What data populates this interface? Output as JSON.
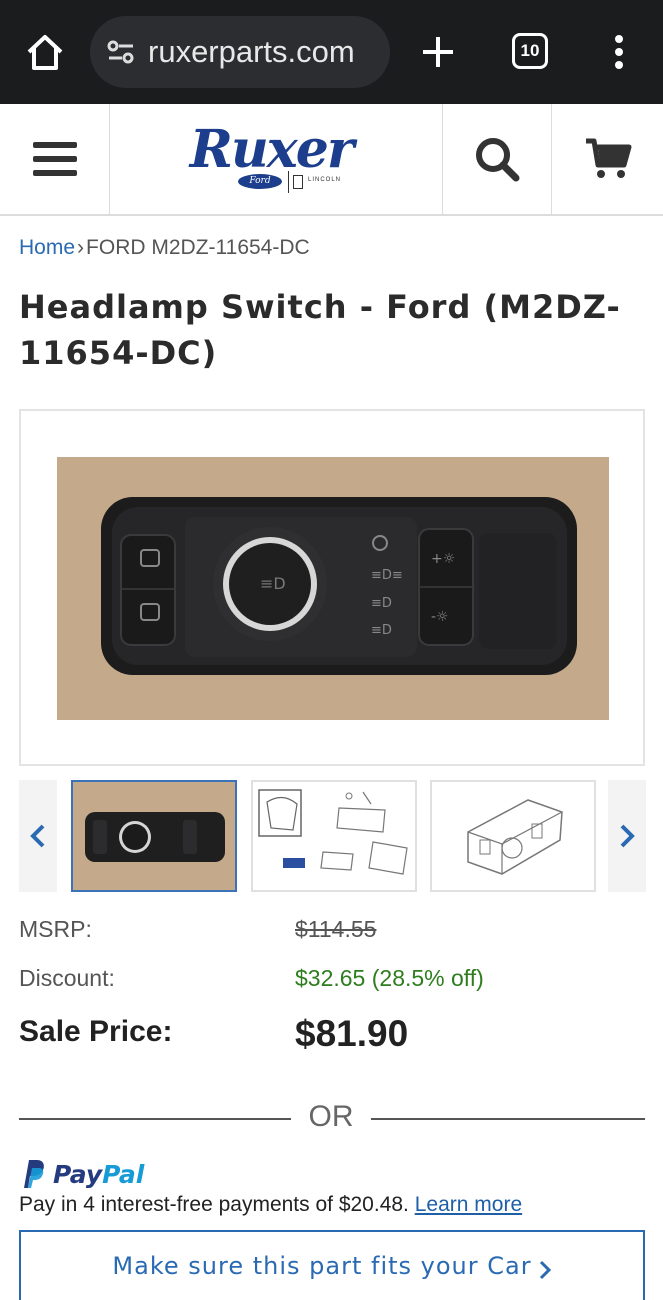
{
  "browser": {
    "url": "ruxerparts.com",
    "tab_count": "10",
    "icons": [
      "home-icon",
      "site-info-icon",
      "plus-icon",
      "tabs-icon",
      "more-vert-icon"
    ]
  },
  "header": {
    "logo_text": "Ruxer",
    "logo_sub_ford": "Ford",
    "logo_sub_lincoln": "LINCOLN",
    "icons": [
      "hamburger-icon",
      "search-icon",
      "cart-icon"
    ],
    "brand_color": "#1d3e8c"
  },
  "breadcrumb": {
    "home": "Home",
    "separator": "›",
    "current": "FORD M2DZ-11654-DC"
  },
  "product": {
    "title": "Headlamp Switch - Ford (M2DZ-11654-DC)"
  },
  "gallery": {
    "selected_index": 0,
    "thumbnail_count": 3,
    "icons": [
      "chevron-left-icon",
      "chevron-right-icon"
    ]
  },
  "pricing": {
    "msrp_label": "MSRP:",
    "msrp_value": "$114.55",
    "discount_label": "Discount:",
    "discount_value": "$32.65 (28.5% off)",
    "sale_label": "Sale Price:",
    "sale_value": "$81.90",
    "discount_color": "#2e7d1e"
  },
  "divider": {
    "text": "OR"
  },
  "paypal": {
    "brand_dark": "Pay",
    "brand_light": "Pal",
    "message": "Pay in 4 interest-free payments of $20.48.",
    "link": "Learn more"
  },
  "fit_check": {
    "label": "Make sure this part fits your Car",
    "accent_color": "#2a6ab2"
  }
}
